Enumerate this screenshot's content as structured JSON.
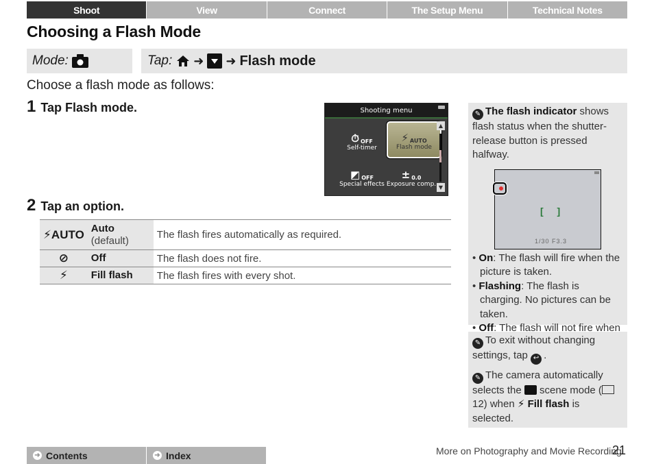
{
  "topnav": {
    "tabs": [
      {
        "label": "Shoot",
        "active": true
      },
      {
        "label": "View",
        "active": false
      },
      {
        "label": "Connect",
        "active": false
      },
      {
        "label": "The Setup Menu",
        "active": false
      },
      {
        "label": "Technical Notes",
        "active": false
      }
    ]
  },
  "page_title": "Choosing a Flash Mode",
  "modebar": {
    "label": "Mode:",
    "icon": "camera-icon"
  },
  "tapbar": {
    "label": "Tap:",
    "icons": [
      "home-icon",
      "menu-down-icon"
    ],
    "arrow": "➜",
    "target": "Flash mode"
  },
  "intro": "Choose a flash mode as follows:",
  "steps": [
    {
      "num": "1",
      "prefix": "Tap ",
      "bold": "Flash mode."
    },
    {
      "num": "2",
      "text": "Tap an option."
    }
  ],
  "camera_screen": {
    "header": "Shooting menu",
    "cells": [
      {
        "icon": "self-timer-icon",
        "glyph": "⏱",
        "value": "OFF",
        "label": "Self-timer",
        "selected": false
      },
      {
        "icon": "flash-auto-icon",
        "glyph": "⚡",
        "value": "AUTO",
        "label": "Flash mode",
        "selected": true
      },
      {
        "icon": "special-effects-icon",
        "glyph": "◩",
        "value": "OFF",
        "label": "Special effects",
        "selected": false
      },
      {
        "icon": "exposure-comp-icon",
        "glyph": "±",
        "value": "0.0",
        "label": "Exposure comp.",
        "selected": false
      }
    ],
    "scroll_up": "▲",
    "scroll_down": "▼"
  },
  "options": [
    {
      "icon_text": "⚡AUTO",
      "icon": "flash-auto-icon",
      "name": "Auto",
      "sub": "(default)",
      "desc": "The flash fires automatically as required."
    },
    {
      "icon_text": "⊘",
      "icon": "flash-off-icon",
      "name": "Off",
      "sub": "",
      "desc": "The flash does not fire."
    },
    {
      "icon_text": "⚡",
      "icon": "fill-flash-icon",
      "name": "Fill flash",
      "sub": "",
      "desc": "The flash fires with every shot."
    }
  ],
  "side1": {
    "bold": "The flash indicator",
    "text": " shows flash status when the shutter-release button is pressed halfway.",
    "viewfinder": {
      "focus": "[ ]",
      "readout": "1/30  F3.3"
    },
    "bullets": [
      {
        "bold": "On",
        "text": ": The flash will fire when the picture is taken."
      },
      {
        "bold": "Flashing",
        "text": ": The flash is charging. No pictures can be taken."
      },
      {
        "bold": "Off",
        "text": ": The flash will not fire when the picture is taken."
      }
    ]
  },
  "side2": {
    "note1_pre": "To exit without changing settings, tap ",
    "note1_icon": "back-icon",
    "note1_post": ".",
    "note2_pre": "The camera automatically selects the ",
    "note2_icon": "scene-backlight-icon",
    "note2_mid": " scene mode (",
    "note2_ref_icon": "book-icon",
    "note2_ref": " 12) when ",
    "note2_bold": "Fill flash",
    "note2_post": " is selected."
  },
  "botnav": {
    "contents": "Contents",
    "index": "Index"
  },
  "footer": {
    "section": "More on Photography and Movie Recording",
    "page": "21"
  }
}
